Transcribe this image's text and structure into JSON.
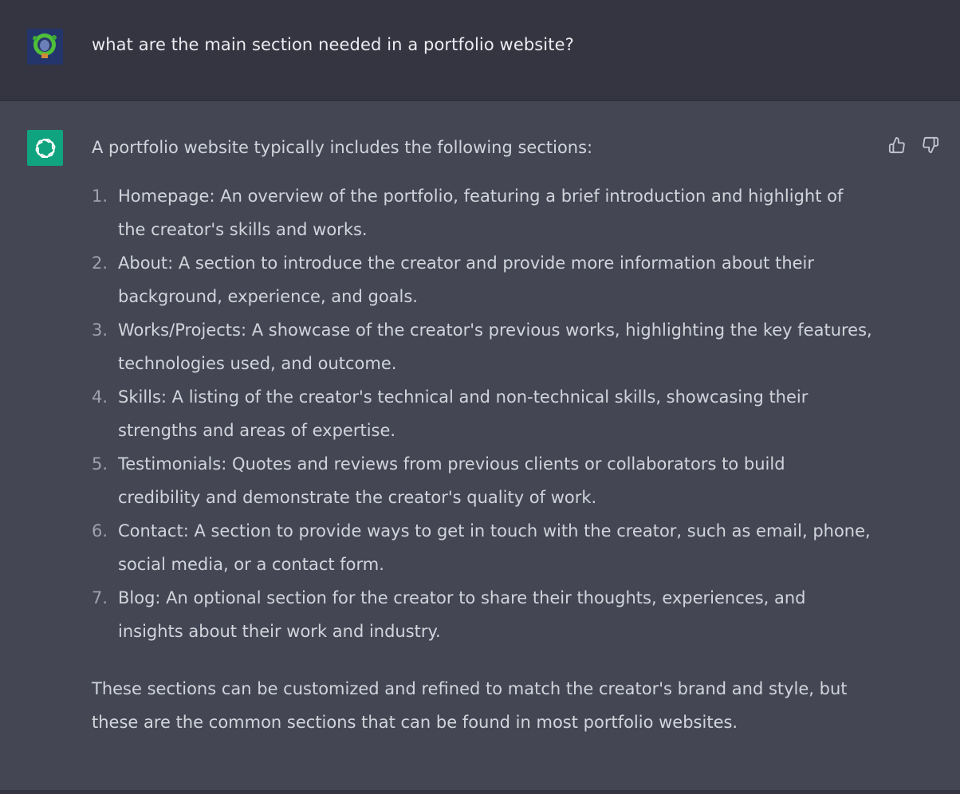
{
  "user_message": {
    "text": "what are the main section needed in a portfolio website?",
    "avatar_icon": "user-avatar-icon"
  },
  "assistant_message": {
    "avatar_icon": "openai-logo-icon",
    "intro": "A portfolio website typically includes the following sections:",
    "items": [
      {
        "number": "1.",
        "lines": [
          "Homepage: An overview of the portfolio, featuring a brief introduction and highlight of",
          "the creator's skills and works."
        ]
      },
      {
        "number": "2.",
        "lines": [
          "About: A section to introduce the creator and provide more information about their",
          "background, experience, and goals."
        ]
      },
      {
        "number": "3.",
        "lines": [
          "Works/Projects: A showcase of the creator's previous works, highlighting the key features,",
          "technologies used, and outcome."
        ]
      },
      {
        "number": "4.",
        "lines": [
          "Skills: A listing of the creator's technical and non-technical skills, showcasing their",
          "strengths and areas of expertise."
        ]
      },
      {
        "number": "5.",
        "lines": [
          "Testimonials: Quotes and reviews from previous clients or collaborators to build",
          "credibility and demonstrate the creator's quality of work."
        ]
      },
      {
        "number": "6.",
        "lines": [
          "Contact: A section to provide ways to get in touch with the creator, such as email, phone,",
          "social media, or a contact form."
        ]
      },
      {
        "number": "7.",
        "lines": [
          "Blog: An optional section for the creator to share their thoughts, experiences, and",
          "insights about their work and industry."
        ]
      }
    ],
    "outro_lines": [
      "These sections can be customized and refined to match the creator's brand and style, but",
      "these are the common sections that can be found in most portfolio websites."
    ]
  },
  "feedback": {
    "thumbs_up_icon": "thumbs-up-icon",
    "thumbs_down_icon": "thumbs-down-icon"
  },
  "colors": {
    "user_bg": "#343541",
    "assistant_bg": "#444654",
    "brand": "#10a37f",
    "text": "#d1d5db"
  }
}
